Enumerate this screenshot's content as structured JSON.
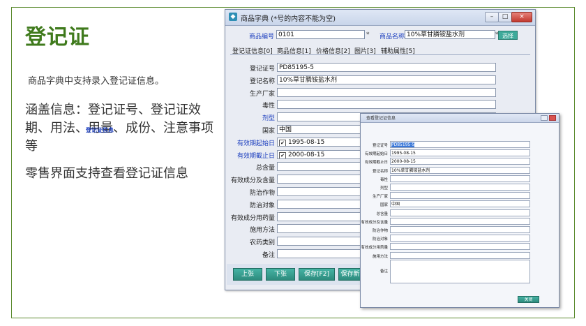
{
  "slide": {
    "title": "登记证",
    "intro": "商品字典中支持录入登记证信息。",
    "para1": "涵盖信息：登记证号、登记证效期、用法、用量、成份、注意事项等",
    "para2": "零售界面支持查看登记证信息"
  },
  "window": {
    "title": "商品字典 (*号的内容不能为空)",
    "min_glyph": "–",
    "max_glyph": "□",
    "close_glyph": "×",
    "code_label": "商品编号",
    "code_value": "0101",
    "name_label": "商品名称",
    "name_value": "10%草甘膦铵盐水剂",
    "required_mark": "*",
    "select_label": "选择",
    "tabs": [
      "登记证信息[0]",
      "商品信息[1]",
      "价格信息[2]",
      "图片[3]",
      "辅助属性[5]"
    ],
    "fields": [
      {
        "label": "登记证号",
        "value": "PD85195-5",
        "color": "#222222"
      },
      {
        "label": "登记名称",
        "value": "10%草甘膦铵盐水剂",
        "color": "#222222"
      },
      {
        "label": "生产厂家",
        "value": "",
        "color": "#222222"
      },
      {
        "label": "毒性",
        "value": "",
        "color": "#222222"
      },
      {
        "label": "剂型",
        "value": "",
        "color": "#1d3fbf"
      },
      {
        "label": "国家",
        "value": "中国",
        "color": "#222222"
      },
      {
        "label": "有效期起始日",
        "value": "1995-08-15",
        "color": "#1d3fbf",
        "checked": true
      },
      {
        "label": "有效期截止日",
        "value": "2000-08-15",
        "color": "#1d3fbf",
        "checked": true
      },
      {
        "label": "总含量",
        "value": "",
        "color": "#222222"
      },
      {
        "label": "有效成分及含量",
        "value": "",
        "color": "#222222"
      },
      {
        "label": "防治作物",
        "value": "",
        "color": "#222222"
      },
      {
        "label": "防治对象",
        "value": "",
        "color": "#222222"
      },
      {
        "label": "有效成分用药量",
        "value": "",
        "color": "#222222"
      },
      {
        "label": "施用方法",
        "value": "",
        "color": "#222222"
      },
      {
        "label": "农药类别",
        "value": "",
        "color": "#222222"
      },
      {
        "label": "备注",
        "value": "",
        "color": "#222222"
      }
    ],
    "buttons": [
      "上张",
      "下张",
      "保存[F2]",
      "保存新"
    ],
    "check_glyph": "✔"
  },
  "dialog": {
    "title": "查看登记证信息",
    "heading": "登记证信息",
    "fields": [
      {
        "label": "登记证号",
        "value": "PD85195-5",
        "highlight": true
      },
      {
        "label": "有效期起始日",
        "value": "1995-08-15"
      },
      {
        "label": "有效期截止日",
        "value": "2000-08-15"
      },
      {
        "label": "登记名称",
        "value": "10%草甘膦铵盐水剂"
      },
      {
        "label": "毒性",
        "value": ""
      },
      {
        "label": "剂型",
        "value": ""
      },
      {
        "label": "生产厂家",
        "value": ""
      },
      {
        "label": "国家",
        "value": "中国"
      },
      {
        "label": "总含量",
        "value": ""
      },
      {
        "label": "有效成分及含量",
        "value": ""
      },
      {
        "label": "防治作物",
        "value": ""
      },
      {
        "label": "防治对象",
        "value": ""
      },
      {
        "label": "有效成分用药量",
        "value": ""
      },
      {
        "label": "施用方法",
        "value": ""
      }
    ],
    "note_label": "备注",
    "close_label": "关闭"
  }
}
